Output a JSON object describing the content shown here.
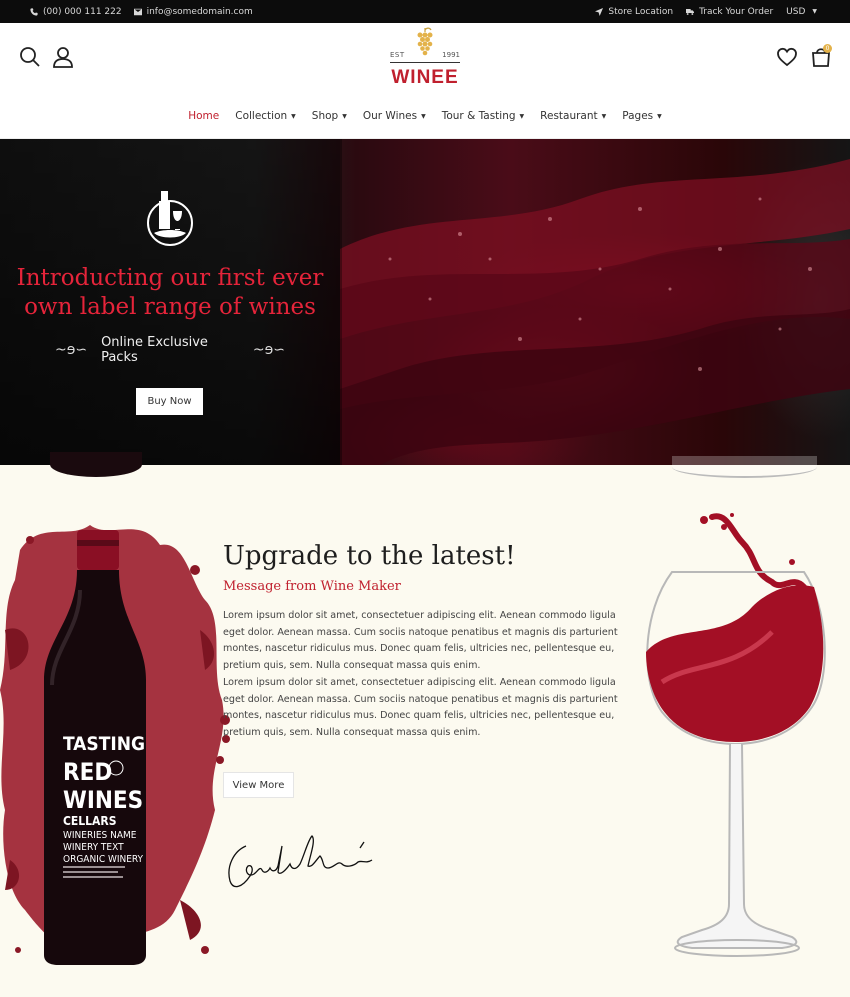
{
  "topbar": {
    "phone": "(00) 000 111 222",
    "email": "info@somedomain.com",
    "store_location": "Store Location",
    "track_order": "Track Your Order",
    "currency": "USD"
  },
  "header": {
    "logo": {
      "est": "EST",
      "year": "1991",
      "name": "WINEE"
    },
    "cart_count": "0",
    "icons": [
      "search-icon",
      "user-icon",
      "heart-icon",
      "cart-icon"
    ]
  },
  "nav": {
    "items": [
      {
        "label": "Home",
        "active": true,
        "has_dropdown": false
      },
      {
        "label": "Collection",
        "has_dropdown": true
      },
      {
        "label": "Shop",
        "has_dropdown": true
      },
      {
        "label": "Our Wines",
        "has_dropdown": true
      },
      {
        "label": "Tour & Tasting",
        "has_dropdown": true
      },
      {
        "label": "Restaurant",
        "has_dropdown": true
      },
      {
        "label": "Pages",
        "has_dropdown": true
      }
    ]
  },
  "hero": {
    "title_line1": "Introducting our first ever",
    "title_line2": "own label range of wines",
    "subtitle": "Online Exclusive Packs",
    "button": "Buy Now"
  },
  "intro": {
    "title": "Upgrade to the latest!",
    "subtitle": "Message from Wine Maker",
    "paragraph1": "Lorem ipsum dolor sit amet, consectetuer adipiscing elit. Aenean commodo ligula eget dolor. Aenean massa. Cum sociis natoque penatibus et magnis dis parturient montes, nascetur ridiculus mus. Donec quam felis, ultricies nec, pellentesque eu, pretium quis, sem. Nulla consequat massa quis enim.",
    "paragraph2": "Lorem ipsum dolor sit amet, consectetuer adipiscing elit. Aenean commodo ligula eget dolor. Aenean massa. Cum sociis natoque penatibus et magnis dis parturient montes, nascetur ridiculus mus. Donec quam felis, ultricies nec, pellentesque eu, pretium quis, sem. Nulla consequat massa quis enim.",
    "button": "View More"
  },
  "bottle_label": {
    "line1": "TASTING",
    "line2": "RED",
    "line3": "WINES",
    "line4": "CELLARS",
    "line5": "WINERIES NAME",
    "line6": "WINERY TEXT",
    "line7": "ORGANIC WINERY"
  },
  "colors": {
    "accent": "#c0202e",
    "topbar": "#0c0c0c",
    "section_bg": "#fcfaf0",
    "gold": "#e3b24a"
  }
}
